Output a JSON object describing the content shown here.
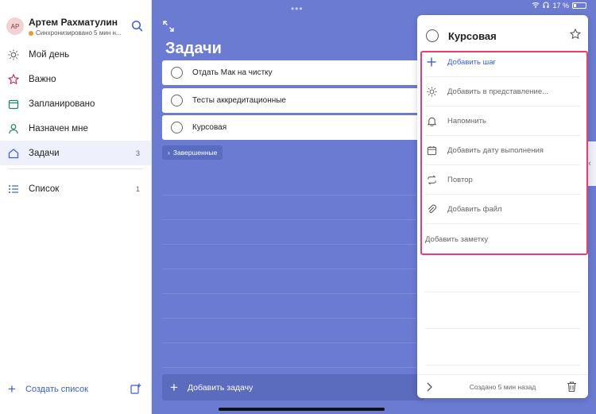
{
  "statusbar": {
    "battery_text": "17 %"
  },
  "profile": {
    "initials": "АР",
    "name": "Артем Рахматулин",
    "sync_status": "Синхронизировано 5 мин н..."
  },
  "nav": [
    {
      "label": "Мой день",
      "icon": "sun-icon",
      "count": ""
    },
    {
      "label": "Важно",
      "icon": "star-icon",
      "count": ""
    },
    {
      "label": "Запланировано",
      "icon": "calendar-icon",
      "count": ""
    },
    {
      "label": "Назначен мне",
      "icon": "person-icon",
      "count": ""
    },
    {
      "label": "Задачи",
      "icon": "home-icon",
      "count": "3"
    }
  ],
  "lists": [
    {
      "label": "Список",
      "icon": "list-icon",
      "count": "1"
    }
  ],
  "create_list": "Создать список",
  "main": {
    "title": "Задачи",
    "tasks": [
      "Отдать Мак на чистку",
      "Тесты аккредитационные",
      "Курсовая"
    ],
    "completed_label": "Завершенные",
    "add_task": "Добавить задачу"
  },
  "detail": {
    "title": "Курсовая",
    "add_step": "Добавить шаг",
    "add_to_day": "Добавить в представление...",
    "remind": "Напомнить",
    "due_date": "Добавить дату выполнения",
    "repeat": "Повтор",
    "add_file": "Добавить файл",
    "add_note": "Добавить заметку",
    "footer": "Создано 5 мин назад"
  },
  "colors": {
    "accent": "#3b5bdb",
    "main_bg": "#6a7bd1",
    "highlight": "#ee3c6e"
  }
}
